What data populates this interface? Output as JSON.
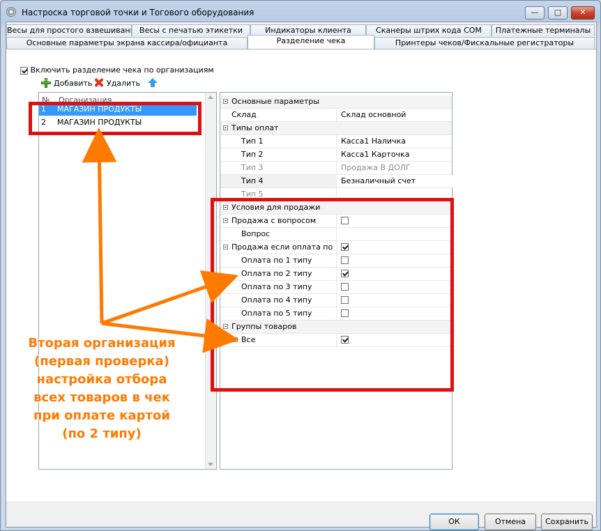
{
  "window": {
    "title": "Настроска торговой точки и Тогового оборудования",
    "minimize_glyph": "—",
    "maximize_glyph": "□",
    "close_glyph": "✕"
  },
  "tabs_row1": [
    "Весы для простого взвешивания",
    "Весы с печатью этикетки",
    "Индикаторы клиента",
    "Сканеры штрих кода COM",
    "Платежные терминалы"
  ],
  "tabs_row2": [
    "Основные параметры экрана кассира/официанта",
    "Разделение чека",
    "Принтеры чеков/Фискальные регистраторы"
  ],
  "active_tab": "Разделение чека",
  "split_checkbox": {
    "label": "Включить разделение чека по организациям",
    "checked": true
  },
  "toolbar": {
    "add": "Добавить",
    "delete": "Удалить"
  },
  "org_list": {
    "columns": [
      "№",
      "Организация"
    ],
    "rows": [
      {
        "num": "1",
        "name": "МАГАЗИН ПРОДУКТЫ",
        "selected": true
      },
      {
        "num": "2",
        "name": "МАГАЗИН ПРОДУКТЫ",
        "selected": false
      }
    ]
  },
  "props": {
    "basic": "Основные параметры",
    "warehouse_label": "Склад",
    "warehouse_value": "Склад основной",
    "pay_types": "Типы оплат",
    "type1_label": "Тип 1",
    "type1_value": "Касса1 Наличка",
    "type2_label": "Тип 2",
    "type2_value": "Касса1 Карточка",
    "type3_label": "Тип 3",
    "type3_value": "Продажа В ДОЛГ",
    "type4_label": "Тип 4",
    "type4_value": "Безналичный счет",
    "type5_label": "Тип 5",
    "sale_conditions": "Условия для продажи",
    "sale_question": "Продажа с вопросом",
    "question": "Вопрос",
    "sale_if_payment": "Продажа если оплата по",
    "pay1": "Оплата по 1 типу",
    "pay2": "Оплата по 2 типу",
    "pay3": "Оплата по 3 типу",
    "pay4": "Оплата по 4 типу",
    "pay5": "Оплата по 5 типу",
    "product_groups": "Группы товаров",
    "all": "Все"
  },
  "checks": {
    "sale_question": false,
    "sale_if_payment": true,
    "pay1": false,
    "pay2": true,
    "pay3": false,
    "pay4": false,
    "pay5": false,
    "all": true
  },
  "annotation": {
    "line1": "Вторая организация",
    "line2": "(первая проверка)",
    "line3": "настройка отбора",
    "line4": "всех товаров в чек",
    "line5": "при оплате картой",
    "line6": "(по 2 типу)"
  },
  "buttons": {
    "ok": "ОК",
    "cancel": "Отмена",
    "save": "Сохранить"
  },
  "colors": {
    "highlight_box": "#e01010",
    "annotation": "#ff7a00",
    "selection": "#3399ff"
  }
}
